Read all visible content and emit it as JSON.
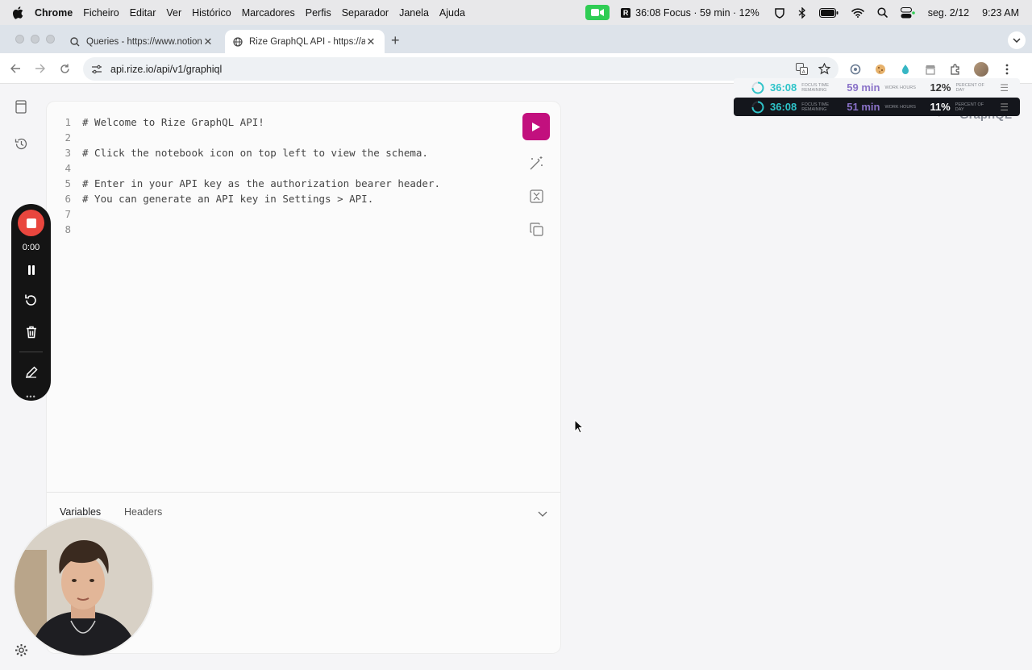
{
  "menubar": {
    "app": "Chrome",
    "items": [
      "Ficheiro",
      "Editar",
      "Ver",
      "Histórico",
      "Marcadores",
      "Perfis",
      "Separador",
      "Janela",
      "Ajuda"
    ],
    "focus_status": "36:08 Focus · 59 min · 12%",
    "rize_badge": "R",
    "date": "seg. 2/12",
    "time": "9:23 AM"
  },
  "tabs": [
    {
      "label": "Queries - https://www.notion.",
      "close": "✕"
    },
    {
      "label": "Rize GraphQL API - https://ap",
      "close": "✕"
    }
  ],
  "newtab": "+",
  "toolbar": {
    "url": "api.rize.io/api/v1/graphiql"
  },
  "editor": {
    "lines": [
      {
        "n": "1",
        "text": "# Welcome to Rize GraphQL API!"
      },
      {
        "n": "2",
        "text": ""
      },
      {
        "n": "3",
        "text": "# Click the notebook icon on top left to view the schema."
      },
      {
        "n": "4",
        "text": ""
      },
      {
        "n": "5",
        "text": "# Enter in your API key as the authorization bearer header."
      },
      {
        "n": "6",
        "text": "# You can generate an API key in Settings > API."
      },
      {
        "n": "7",
        "text": ""
      },
      {
        "n": "8",
        "text": ""
      }
    ],
    "tabs": {
      "variables": "Variables",
      "headers": "Headers"
    }
  },
  "right_pane": {
    "title": "GraphQL"
  },
  "rize_widget": [
    {
      "focus_time": "36:08",
      "focus_label": "FOCUS TIME REMAINING",
      "work": "59 min",
      "work_label": "WORK HOURS",
      "percent": "12%",
      "percent_label": "PERCENT OF DAY",
      "theme": "light"
    },
    {
      "focus_time": "36:08",
      "focus_label": "FOCUS TIME REMAINING",
      "work": "51 min",
      "work_label": "WORK HOURS",
      "percent": "11%",
      "percent_label": "PERCENT OF DAY",
      "theme": "dark"
    }
  ],
  "recorder": {
    "elapsed": "0:00",
    "more": "•••"
  },
  "colors": {
    "run_button": "#c2107e",
    "record": "#e9463e",
    "camera_green": "#2fcd54",
    "teal": "#2fc4c9",
    "purple": "#8a72c8"
  }
}
